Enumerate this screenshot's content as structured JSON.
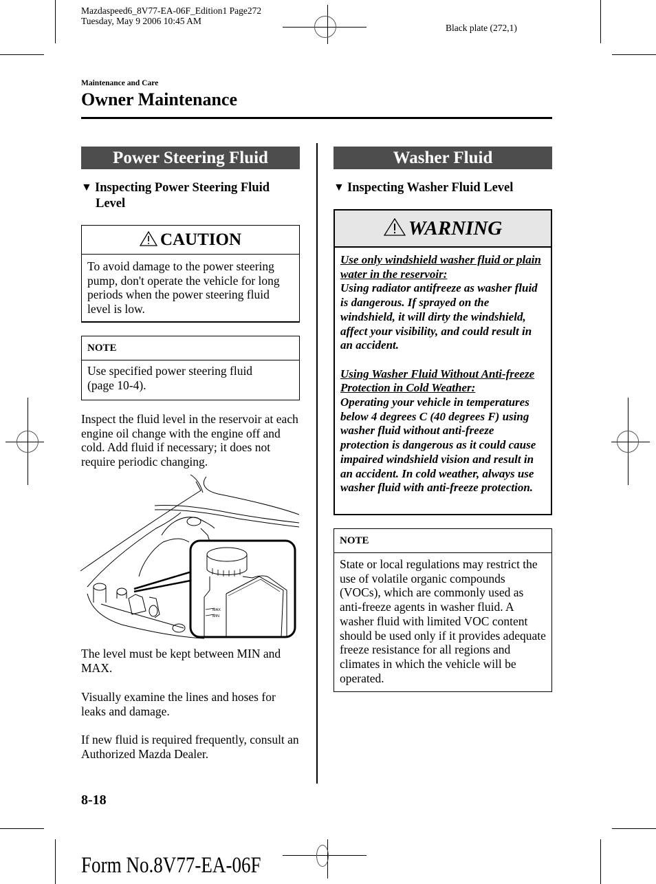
{
  "print_slug": {
    "line1": "Mazdaspeed6_8V77-EA-06F_Edition1 Page272",
    "line2": "Tuesday, May 9 2006 10:45 AM",
    "plate": "Black plate (272,1)"
  },
  "header": {
    "section": "Maintenance and Care",
    "title": "Owner Maintenance"
  },
  "left_column": {
    "section_title": "Power Steering Fluid",
    "subheading_line1": "Inspecting Power Steering Fluid",
    "subheading_line2": "Level",
    "caution": {
      "icon": "warning-triangle-icon",
      "title": "CAUTION",
      "body": "To avoid damage to the power steering pump, don't operate the vehicle for long periods when the power steering fluid level is low."
    },
    "note": {
      "title": "NOTE",
      "body_line1": "Use specified power steering fluid",
      "body_line2": "(page 10-4)."
    },
    "paragraph_inspect": "Inspect the fluid level in the reservoir at each engine oil change with the engine off and cold. Add fluid if necessary; it does not require periodic changing.",
    "illustration": {
      "description": "Engine bay with power steering fluid reservoir inset",
      "labels": [
        "MAX",
        "MIN"
      ]
    },
    "paragraph_level": "The level must be kept between MIN and MAX.",
    "paragraph_examine": "Visually examine the lines and hoses for leaks and damage.",
    "paragraph_consult": "If new fluid is required frequently, consult an Authorized Mazda Dealer."
  },
  "right_column": {
    "section_title": "Washer Fluid",
    "subheading": "Inspecting Washer Fluid Level",
    "warning": {
      "icon": "warning-triangle-icon",
      "title": "WARNING",
      "item1_heading": "Use only windshield washer fluid or plain water in the reservoir:",
      "item1_body": "Using radiator antifreeze as washer fluid is dangerous. If sprayed on the windshield, it will dirty the windshield, affect your visibility, and could result in an accident.",
      "item2_heading": "Using Washer Fluid Without Anti-freeze Protection in Cold Weather:",
      "item2_body": "Operating your vehicle in temperatures below 4 degrees C (40 degrees F) using washer fluid without anti-freeze protection is dangerous as it could cause impaired windshield vision and result in an accident. In cold weather, always use washer fluid with anti-freeze protection."
    },
    "note": {
      "title": "NOTE",
      "body": "State or local regulations may restrict the use of volatile organic compounds (VOCs), which are commonly used as anti-freeze agents in washer fluid. A washer fluid with limited VOC content should be used only if it provides adequate freeze resistance for all regions and climates in which the vehicle will be operated."
    }
  },
  "footer": {
    "page_number": "8-18",
    "form_number": "Form No.8V77-EA-06F"
  }
}
